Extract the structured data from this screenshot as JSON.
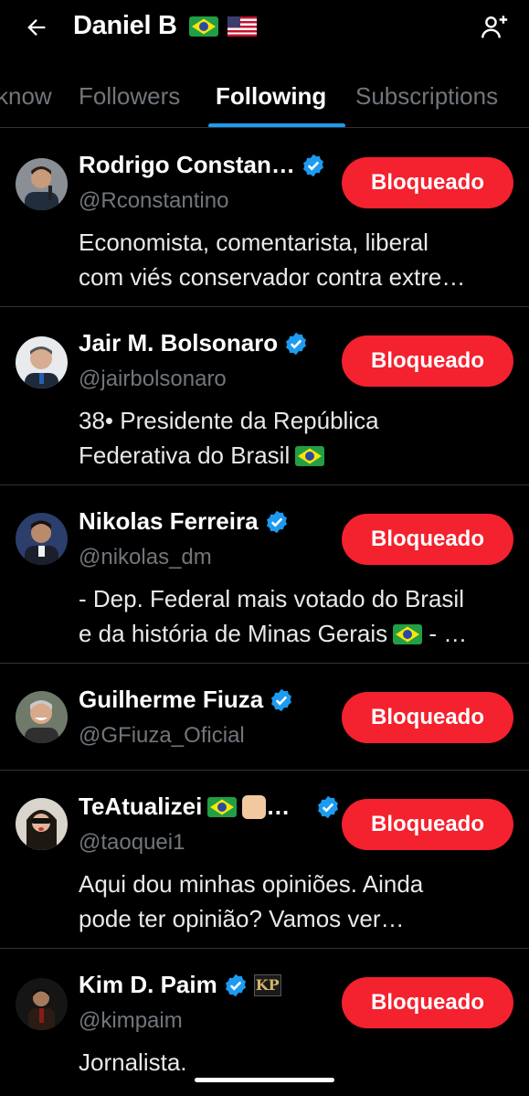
{
  "header": {
    "title": "Daniel B",
    "back_icon": "arrow-left-icon",
    "add_user_icon": "person-add-icon"
  },
  "tabs": [
    {
      "label": "know",
      "active": false
    },
    {
      "label": "Followers",
      "active": false
    },
    {
      "label": "Following",
      "active": true
    },
    {
      "label": "Subscriptions",
      "active": false
    }
  ],
  "users": [
    {
      "name": "Rodrigo Constan…",
      "handle": "@Rconstantino",
      "bio": [
        "Economista, comentarista, liberal",
        "com viés conservador contra extre…"
      ],
      "button": "Bloqueado",
      "verified": true
    },
    {
      "name": "Jair M. Bolsonaro",
      "handle": "@jairbolsonaro",
      "bio": [
        "38• Presidente da República",
        "Federativa do Brasil"
      ],
      "button": "Bloqueado",
      "verified": true
    },
    {
      "name": "Nikolas Ferreira",
      "handle": "@nikolas_dm",
      "bio": [
        "- Dep. Federal mais votado do Brasil",
        "e da história de Minas Gerais"
      ],
      "bio_tail": "- …",
      "button": "Bloqueado",
      "verified": true
    },
    {
      "name": "Guilherme Fiuza",
      "handle": "@GFiuza_Oficial",
      "bio": [],
      "button": "Bloqueado",
      "verified": true
    },
    {
      "name": "TeAtualizei",
      "name_tail": "…",
      "handle": "@taoquei1",
      "bio": [
        "Aqui dou minhas opiniões. Ainda",
        "pode ter opinião? Vamos ver…"
      ],
      "button": "Bloqueado",
      "verified": true
    },
    {
      "name": "Kim D. Paim",
      "handle": "@kimpaim",
      "bio": [
        "Jornalista."
      ],
      "button": "Bloqueado",
      "verified": true,
      "badge_text": "KP"
    }
  ],
  "colors": {
    "accent": "#1d9bf0",
    "block": "#f4212e",
    "muted": "#71767b",
    "divider": "#2f3336"
  }
}
